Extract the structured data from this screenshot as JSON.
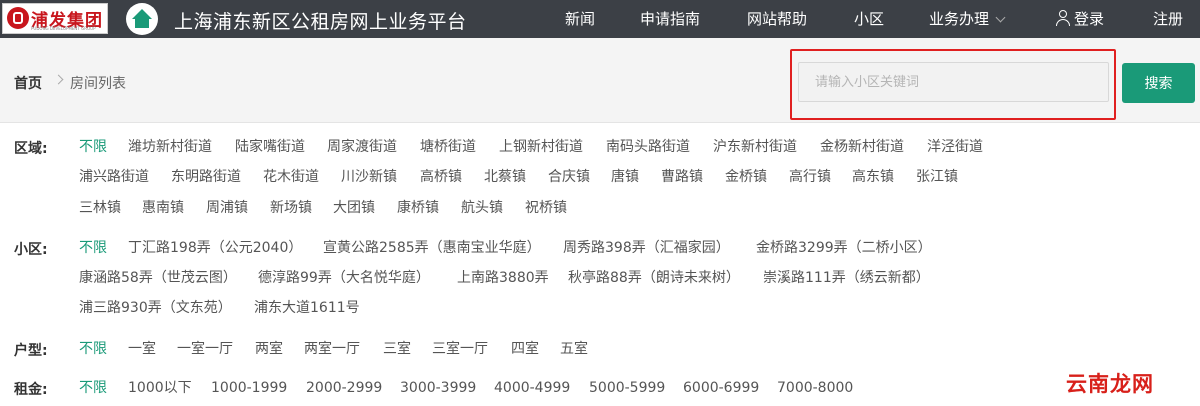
{
  "brand": {
    "name": "浦发集团",
    "sub": "PUDONG DEVELOPMENT GROUP"
  },
  "site": {
    "title": "上海浦东新区公租房网上业务平台"
  },
  "nav": {
    "items": [
      "新闻",
      "申请指南",
      "网站帮助",
      "小区",
      "业务办理",
      "登录",
      "注册"
    ]
  },
  "breadcrumb": {
    "home": "首页",
    "current": "房间列表"
  },
  "search": {
    "placeholder": "请输入小区关键词",
    "button": "搜索"
  },
  "filters": {
    "district": {
      "label": "区域:",
      "options": [
        "不限",
        "潍坊新村街道",
        "陆家嘴街道",
        "周家渡街道",
        "塘桥街道",
        "上钢新村街道",
        "南码头路街道",
        "沪东新村街道",
        "金杨新村街道",
        "洋泾街道",
        "浦兴路街道",
        "东明路街道",
        "花木街道",
        "川沙新镇",
        "高桥镇",
        "北蔡镇",
        "合庆镇",
        "唐镇",
        "曹路镇",
        "金桥镇",
        "高行镇",
        "高东镇",
        "张江镇",
        "三林镇",
        "惠南镇",
        "周浦镇",
        "新场镇",
        "大团镇",
        "康桥镇",
        "航头镇",
        "祝桥镇"
      ]
    },
    "community": {
      "label": "小区:",
      "options": [
        "不限",
        "丁汇路198弄（公元2040）",
        "宣黄公路2585弄（惠南宝业华庭）",
        "周秀路398弄（汇福家园）",
        "金桥路3299弄（二桥小区）",
        "康涵路58弄（世茂云图）",
        "德淳路99弄（大名悦华庭）",
        "上南路3880弄",
        "秋亭路88弄（朗诗未来树）",
        "崇溪路111弄（绣云新都）",
        "浦三路930弄（文东苑）",
        "浦东大道1611号"
      ]
    },
    "layout": {
      "label": "户型:",
      "options": [
        "不限",
        "一室",
        "一室一厅",
        "两室",
        "两室一厅",
        "三室",
        "三室一厅",
        "四室",
        "五室"
      ]
    },
    "rent": {
      "label": "租金:",
      "options": [
        "不限",
        "1000以下",
        "1000-1999",
        "2000-2999",
        "3000-3999",
        "4000-4999",
        "5000-5999",
        "6000-6999",
        "7000-8000"
      ]
    }
  },
  "watermark": "云南龙网",
  "colors": {
    "accent": "#1a9a78",
    "topbar": "#3c4046",
    "highlight": "#e02020"
  }
}
